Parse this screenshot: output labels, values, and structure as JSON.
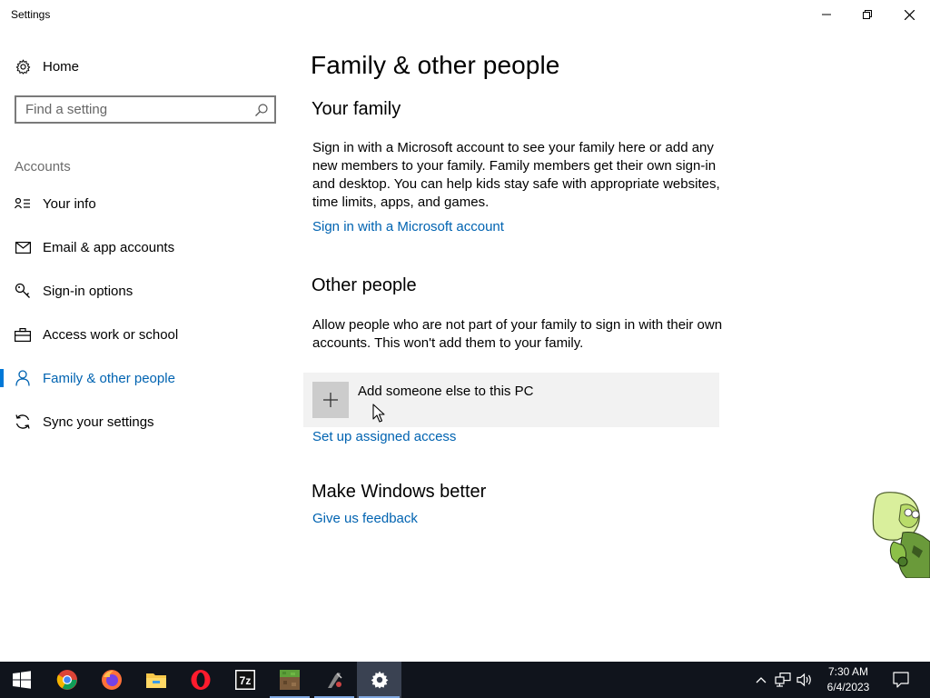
{
  "window": {
    "title": "Settings",
    "controls": {
      "minimize": "minimize-icon",
      "restore": "restore-icon",
      "close": "close-icon"
    }
  },
  "sidebar": {
    "home_label": "Home",
    "search_placeholder": "Find a setting",
    "section_label": "Accounts",
    "items": [
      {
        "label": "Your info",
        "icon": "contact-card-icon",
        "active": false
      },
      {
        "label": "Email & app accounts",
        "icon": "mail-icon",
        "active": false
      },
      {
        "label": "Sign-in options",
        "icon": "key-icon",
        "active": false
      },
      {
        "label": "Access work or school",
        "icon": "briefcase-icon",
        "active": false
      },
      {
        "label": "Family & other people",
        "icon": "person-icon",
        "active": true
      },
      {
        "label": "Sync your settings",
        "icon": "sync-icon",
        "active": false
      }
    ]
  },
  "main": {
    "title": "Family & other people",
    "your_family": {
      "heading": "Your family",
      "description": "Sign in with a Microsoft account to see your family here or add any new members to your family. Family members get their own sign-in and desktop. You can help kids stay safe with appropriate websites, time limits, apps, and games.",
      "link": "Sign in with a Microsoft account"
    },
    "other_people": {
      "heading": "Other people",
      "description": "Allow people who are not part of your family to sign in with their own accounts. This won't add them to your family.",
      "add_button": "Add someone else to this PC",
      "link": "Set up assigned access"
    },
    "make_better": {
      "heading": "Make Windows better",
      "link": "Give us feedback"
    }
  },
  "taskbar": {
    "apps": [
      "start-icon",
      "chrome-icon",
      "firefox-icon",
      "file-explorer-icon",
      "opera-icon",
      "7zip-icon",
      "minecraft-icon",
      "game-icon",
      "settings-icon"
    ],
    "active_app": "settings-icon",
    "clock_time": "7:30 AM",
    "clock_date": "6/4/2023"
  },
  "colors": {
    "accent": "#0078d7",
    "link": "#0063b1",
    "taskbar": "#10141c"
  }
}
